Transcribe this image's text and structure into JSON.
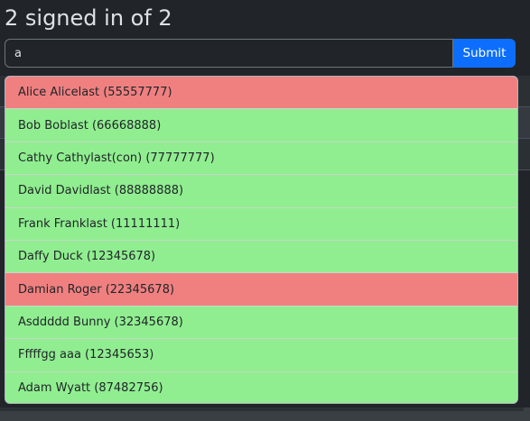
{
  "header": {
    "partial_title": "...",
    "signed_in_text": "2 signed in of 2"
  },
  "search": {
    "value": "a",
    "placeholder": "",
    "submit_label": "Submit"
  },
  "colors": {
    "signed_in": "#90ee90",
    "not_signed_in": "#f08080",
    "submit_button": "#0d6efd",
    "page_background": "#212529"
  },
  "suggestions": [
    {
      "label": "Alice Alicelast (55557777)",
      "status": "not_signed_in"
    },
    {
      "label": "Bob Boblast (66668888)",
      "status": "signed_in"
    },
    {
      "label": "Cathy Cathylast(con) (77777777)",
      "status": "signed_in"
    },
    {
      "label": "David Davidlast (88888888)",
      "status": "signed_in"
    },
    {
      "label": "Frank Franklast (11111111)",
      "status": "signed_in"
    },
    {
      "label": "Daffy Duck (12345678)",
      "status": "signed_in"
    },
    {
      "label": "Damian Roger (22345678)",
      "status": "not_signed_in"
    },
    {
      "label": "Asddddd Bunny (32345678)",
      "status": "signed_in"
    },
    {
      "label": "Fffffgg aaa (12345653)",
      "status": "signed_in"
    },
    {
      "label": "Adam Wyatt (87482756)",
      "status": "signed_in"
    }
  ]
}
